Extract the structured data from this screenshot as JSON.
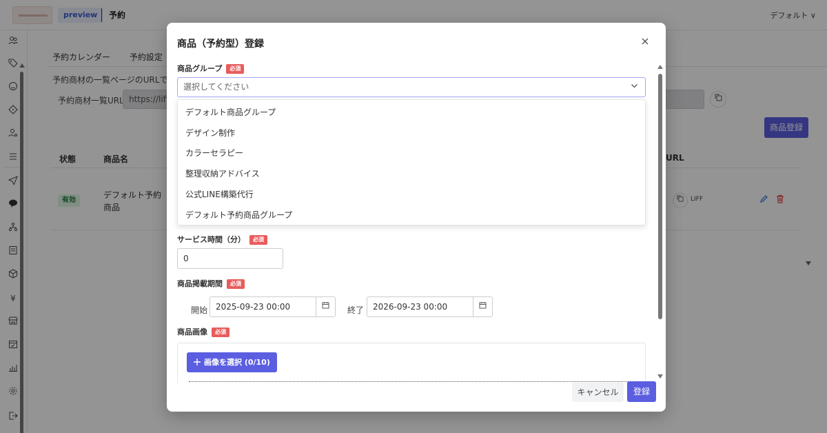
{
  "topbar": {
    "preview_badge": "preview",
    "page_title": "予約",
    "default_dropdown": "デフォルト ∨"
  },
  "main": {
    "tabs": [
      {
        "label": "予約カレンダー"
      },
      {
        "label": "予約設定"
      }
    ],
    "url_description": "予約商材の一覧ページのURLです",
    "url_label": "予約商材一覧URL",
    "url_value": "https://liff.",
    "register_button": "商品登録",
    "table": {
      "headers": [
        "状態",
        "商品名",
        "URL"
      ],
      "rows": [
        {
          "status": "有効",
          "name": "デフォルト予約商品",
          "link": "LIFF"
        }
      ]
    }
  },
  "modal": {
    "title": "商品（予約型）登録",
    "required_badge": "必須",
    "product_group": {
      "label": "商品グループ",
      "placeholder": "選択してください",
      "options": [
        "デフォルト商品グループ",
        "デザイン制作",
        "カラーセラピー",
        "整理収納アドバイス",
        "公式LINE構築代行",
        "デフォルト予約商品グループ"
      ]
    },
    "service_time": {
      "label": "サービス時間（分）",
      "value": "0"
    },
    "listing_period": {
      "label": "商品掲載期間",
      "start_label": "開始",
      "start_value": "2025-09-23 00:00",
      "end_label": "終了",
      "end_value": "2026-09-23 00:00"
    },
    "product_image": {
      "label": "商品画像",
      "select_button": "画像を選択 (0/10)"
    },
    "cancel_button": "キャンセル",
    "save_button": "登録"
  },
  "colors": {
    "accent": "#5b5ee0",
    "required": "#e85c5c",
    "status_valid_bg": "#def5e3"
  },
  "icons": {
    "close": "close-icon",
    "chevron": "chevron-down-icon",
    "calendar": "calendar-icon",
    "plus": "plus-icon",
    "copy": "copy-icon",
    "edit": "pencil-icon",
    "delete": "trash-icon"
  }
}
